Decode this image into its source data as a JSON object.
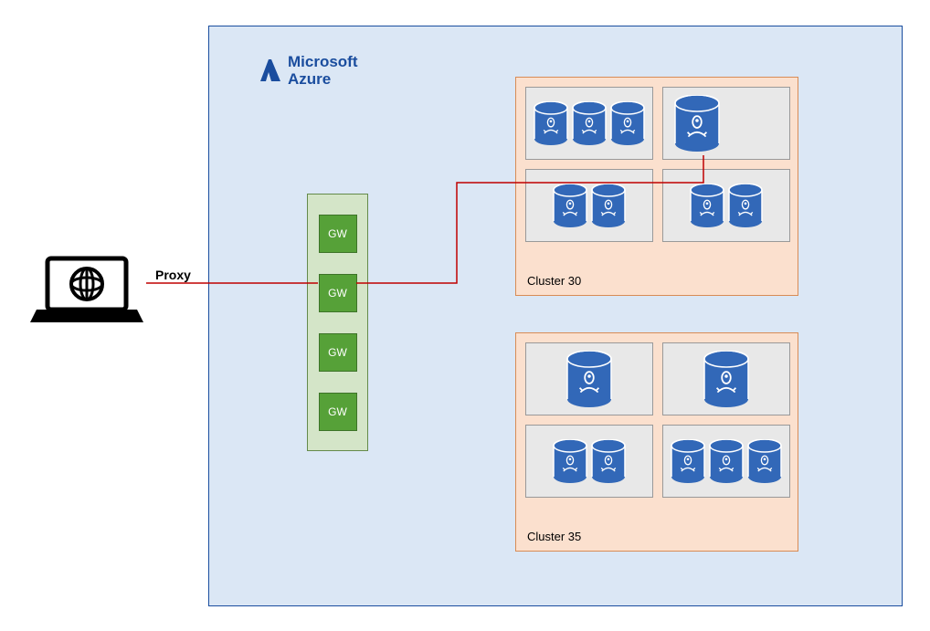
{
  "azure": {
    "brand_line1": "Microsoft",
    "brand_line2": "Azure"
  },
  "proxy_label": "Proxy",
  "gateways": [
    "GW",
    "GW",
    "GW",
    "GW"
  ],
  "clusters": [
    {
      "name": "Cluster 30",
      "pods": [
        {
          "position": "tl",
          "db_count": 3,
          "size": "small"
        },
        {
          "position": "tr",
          "db_count": 1,
          "size": "large"
        },
        {
          "position": "bl",
          "db_count": 2,
          "size": "small"
        },
        {
          "position": "br",
          "db_count": 2,
          "size": "small"
        }
      ]
    },
    {
      "name": "Cluster 35",
      "pods": [
        {
          "position": "tl",
          "db_count": 1,
          "size": "large"
        },
        {
          "position": "tr",
          "db_count": 1,
          "size": "large"
        },
        {
          "position": "bl",
          "db_count": 2,
          "size": "small"
        },
        {
          "position": "br",
          "db_count": 3,
          "size": "small"
        }
      ]
    }
  ],
  "colors": {
    "azure_border": "#1a4d9e",
    "azure_bg": "#dbe7f5",
    "gateway_bg": "#56a138",
    "cluster_bg": "#fbe0ce",
    "connection": "#c00000",
    "db_fill": "#3268b8"
  }
}
